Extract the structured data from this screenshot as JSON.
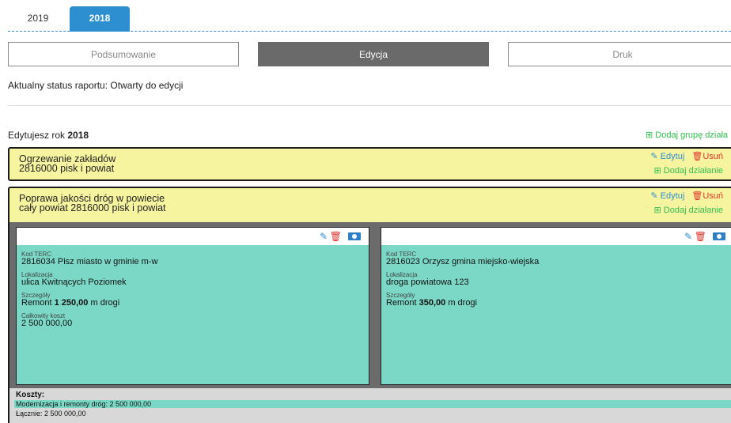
{
  "year_tabs": [
    {
      "label": "2019",
      "active": false
    },
    {
      "label": "2018",
      "active": true
    }
  ],
  "view_buttons": {
    "summary": "Podsumowanie",
    "edit": "Edycja",
    "print": "Druk"
  },
  "status_text": "Aktualny status raportu: Otwarty do edycji",
  "editing": {
    "prefix": "Edytujesz rok",
    "year": "2018",
    "add_group": "Dodaj grupę działa"
  },
  "actions": {
    "edit": "Edytuj",
    "delete": "Usuń",
    "add_action": "Dodaj działanie"
  },
  "groups": [
    {
      "title": "Ogrzewanie zakładów",
      "subtitle": "2816000 pisk i powiat"
    },
    {
      "title": "Poprawa jakości dróg w powiecie",
      "subtitle": "cały powiat 2816000 pisk i powiat"
    }
  ],
  "cards": [
    {
      "terc_label": "Kod TERC",
      "terc_value": "2816034 Pisz miasto w gminie m-w",
      "location_label": "Lokalizacja",
      "location_value": "ulica Kwitnących Poziomek",
      "details_label": "Szczegóły",
      "details_prefix": "Remont",
      "details_amount": "1 250,00",
      "details_suffix": "m drogi",
      "cost_label": "Całkowity koszt",
      "cost_value": "2 500 000,00"
    },
    {
      "terc_label": "Kod TERC",
      "terc_value": "2816023 Orzysz gmina miejsko-wiejska",
      "location_label": "Lokalizacja",
      "location_value": "droga powiatowa 123",
      "details_label": "Szczegóły",
      "details_prefix": "Remont",
      "details_amount": "350,00",
      "details_suffix": "m drogi"
    }
  ],
  "costs": {
    "title": "Koszty:",
    "item": "Modernizacja i remonty dróg: 2 500 000,00",
    "total": "Łącznie: 2 500 000,00"
  },
  "colors": {
    "accent_blue": "#2d8fd0",
    "group_yellow": "#f7f4a0",
    "card_teal": "#7bd8c6",
    "add_green": "#2fbf4f",
    "delete_red": "#e0342a"
  },
  "icons": [
    "edit-icon",
    "trash-icon",
    "money-icon",
    "plus-square-icon"
  ]
}
